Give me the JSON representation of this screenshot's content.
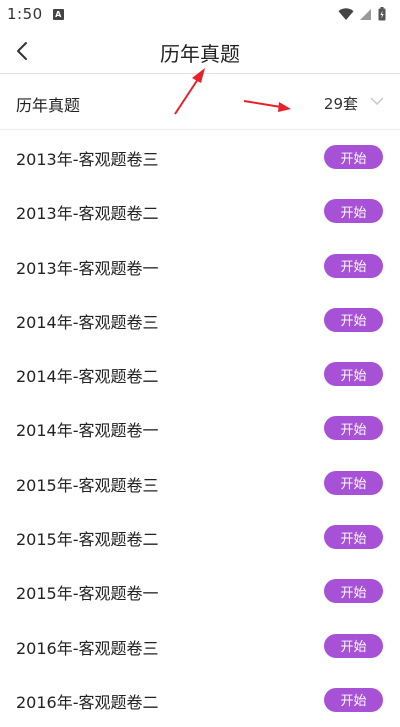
{
  "status_bar": {
    "time": "1:50",
    "app_badge": "A"
  },
  "header": {
    "title": "历年真题"
  },
  "filter": {
    "label": "历年真题",
    "count": "29套"
  },
  "items": [
    {
      "title": "2013年-客观题卷三",
      "button": "开始"
    },
    {
      "title": "2013年-客观题卷二",
      "button": "开始"
    },
    {
      "title": "2013年-客观题卷一",
      "button": "开始"
    },
    {
      "title": "2014年-客观题卷三",
      "button": "开始"
    },
    {
      "title": "2014年-客观题卷二",
      "button": "开始"
    },
    {
      "title": "2014年-客观题卷一",
      "button": "开始"
    },
    {
      "title": "2015年-客观题卷三",
      "button": "开始"
    },
    {
      "title": "2015年-客观题卷二",
      "button": "开始"
    },
    {
      "title": "2015年-客观题卷一",
      "button": "开始"
    },
    {
      "title": "2016年-客观题卷三",
      "button": "开始"
    },
    {
      "title": "2016年-客观题卷二",
      "button": "开始"
    }
  ],
  "colors": {
    "accent": "#a651d6",
    "annotation_arrow": "#e8202a",
    "divider": "#e2e2e2"
  },
  "icons": {
    "back": "back-arrow-icon",
    "dropdown": "chevron-down-icon",
    "wifi": "wifi-icon",
    "signal": "signal-icon",
    "battery": "battery-icon"
  }
}
